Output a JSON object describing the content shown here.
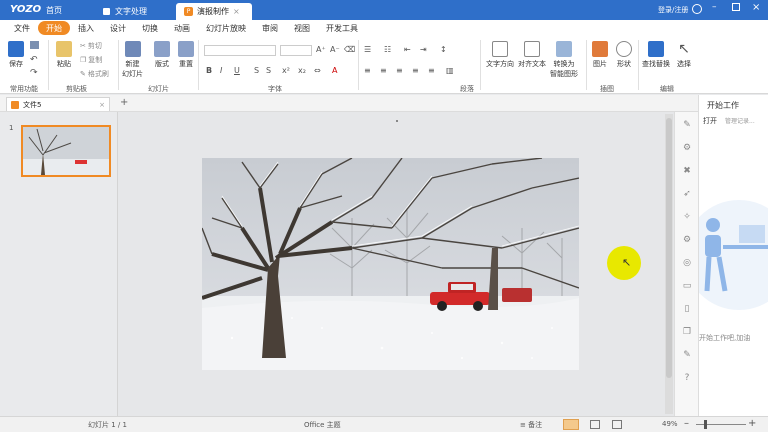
{
  "titlebar": {
    "logo": "YOZO",
    "home_tab": "首页",
    "tabs": [
      {
        "label": "文字处理",
        "icon": "word-icon",
        "color": "#2f6fc9"
      },
      {
        "label": "演报制作",
        "icon": "presentation-icon",
        "color": "#f08a24"
      }
    ],
    "login": "登录/注册"
  },
  "menu": [
    "文件",
    "开始",
    "插入",
    "设计",
    "切换",
    "动画",
    "幻灯片放映",
    "审阅",
    "视图",
    "开发工具"
  ],
  "ribbon": {
    "save": "保存",
    "common_group": "常用功能",
    "paste": "粘贴",
    "cut": "剪切",
    "copy": "复制",
    "format_painter": "格式刷",
    "clipboard_group": "剪贴板",
    "new_slide_1": "新建",
    "new_slide_2": "幻灯片",
    "layout": "版式",
    "reset": "重置",
    "slides_group": "幻灯片",
    "font_group": "字体",
    "paragraph_group": "段落",
    "text_direction": "文字方向",
    "align_text": "对齐文本",
    "convert_1": "转换为",
    "convert_2": "智能图形",
    "picture": "图片",
    "shape": "形状",
    "draw_group": "插图",
    "find_replace": "查找替换",
    "select": "选择",
    "edit_group": "编辑"
  },
  "doc": {
    "tab_label": "文件5",
    "add": "+"
  },
  "thumbs": {
    "number": "1"
  },
  "taskpane": {
    "title": "开始工作",
    "open": "打开",
    "manage": "管理记录...",
    "hint": "开始工作吧,加油"
  },
  "status": {
    "slide": "幻灯片 1 / 1",
    "theme": "Office 主题",
    "notes": "备注",
    "zoom": "49%"
  },
  "colors": {
    "titlebar": "#2f6fc9",
    "accent": "#f08a24",
    "cursor_highlight": "#e8e800"
  }
}
